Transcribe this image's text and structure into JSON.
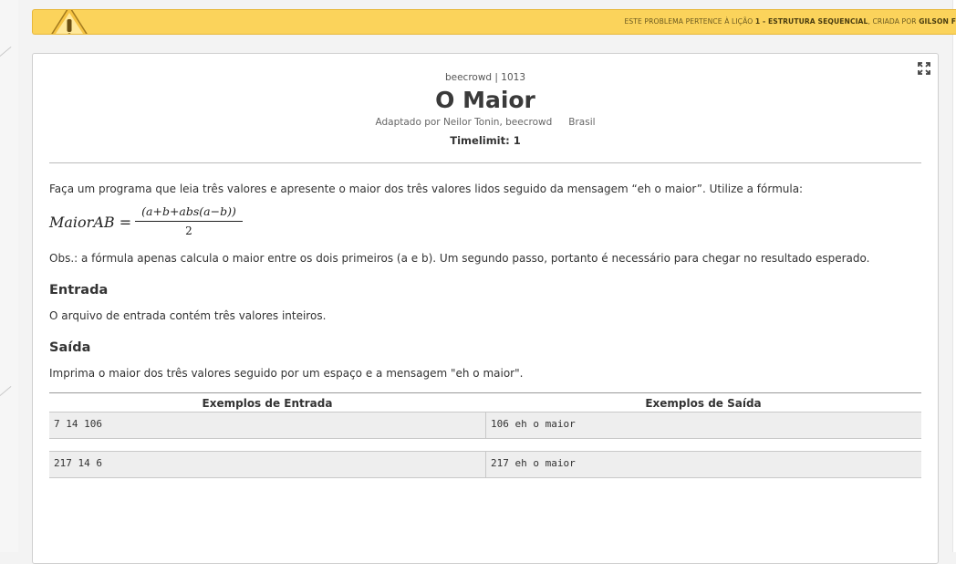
{
  "warning": {
    "prefix": "ESTE PROBLEMA PERTENCE À LIÇÃO ",
    "lesson": "1 - ESTRUTURA SEQUENCIAL",
    "middle": ", CRIADA POR ",
    "author": "GILSON F"
  },
  "problem": {
    "breadcrumb": "beecrowd | 1013",
    "title": "O Maior",
    "adapted_by": "Adaptado por Neilor Tonin, beecrowd",
    "country": "Brasil",
    "timelimit": "Timelimit: 1"
  },
  "description": {
    "intro": "Faça um programa que leia três valores e apresente o maior dos três valores lidos seguido da mensagem “eh o maior”. Utilize a fórmula:",
    "formula_lhs": "MaiorAB =",
    "formula_numerator": "(a+b+abs(a−b))",
    "formula_denominator": "2",
    "obs": "Obs.: a fórmula apenas calcula o maior entre os dois primeiros (a e b). Um segundo passo, portanto é necessário para chegar no resultado esperado."
  },
  "input_section": {
    "title": "Entrada",
    "text": "O arquivo de entrada contém três valores inteiros."
  },
  "output_section": {
    "title": "Saída",
    "text": "Imprima o maior dos três valores seguido por um espaço e a mensagem \"eh o maior\"."
  },
  "examples": {
    "input_header": "Exemplos de Entrada",
    "output_header": "Exemplos de Saída",
    "rows": [
      {
        "input": "7 14 106",
        "output": "106 eh o maior"
      },
      {
        "input": "217 14 6",
        "output": "217 eh o maior"
      }
    ]
  },
  "icons": {
    "warning": "warning-triangle-icon",
    "expand": "expand-fullscreen-icon"
  },
  "colors": {
    "warning_bg": "#fbd35b",
    "card_bg": "#ffffff",
    "example_bg": "#eeeeee"
  }
}
